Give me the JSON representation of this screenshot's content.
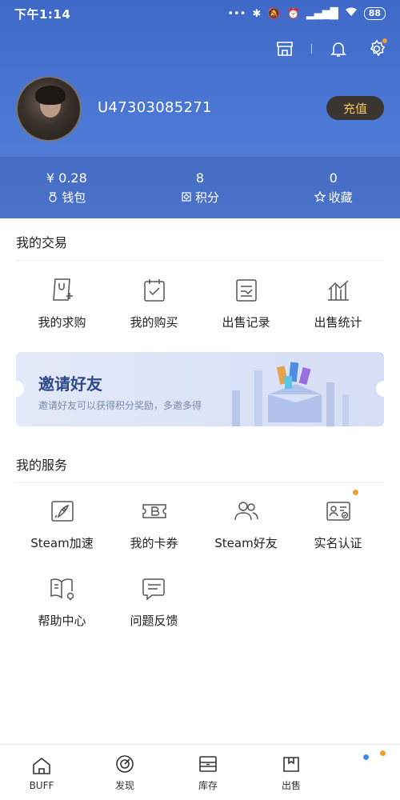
{
  "status_bar": {
    "time": "下午1:14",
    "signal": "...",
    "battery": "88"
  },
  "header": {
    "username": "U47303085271",
    "recharge_label": "充值",
    "stats": [
      {
        "value": "¥ 0.28",
        "label": "钱包",
        "icon": "wallet-icon"
      },
      {
        "value": "8",
        "label": "积分",
        "icon": "points-icon"
      },
      {
        "value": "0",
        "label": "收藏",
        "icon": "star-icon"
      }
    ]
  },
  "trade": {
    "title": "我的交易",
    "items": [
      {
        "label": "我的求购",
        "icon": "want-to-buy-icon"
      },
      {
        "label": "我的购买",
        "icon": "purchases-icon"
      },
      {
        "label": "出售记录",
        "icon": "sales-record-icon"
      },
      {
        "label": "出售统计",
        "icon": "sales-stats-icon"
      }
    ]
  },
  "banner": {
    "title": "邀请好友",
    "subtitle": "邀请好友可以获得积分奖励，多邀多得"
  },
  "services": {
    "title": "我的服务",
    "items": [
      {
        "label": "Steam加速",
        "icon": "rocket-icon"
      },
      {
        "label": "我的卡券",
        "icon": "coupon-icon"
      },
      {
        "label": "Steam好友",
        "icon": "friends-icon"
      },
      {
        "label": "实名认证",
        "icon": "id-card-icon"
      },
      {
        "label": "帮助中心",
        "icon": "help-book-icon"
      },
      {
        "label": "问题反馈",
        "icon": "feedback-icon"
      }
    ]
  },
  "bottom_nav": [
    {
      "label": "BUFF",
      "icon": "home-icon"
    },
    {
      "label": "发现",
      "icon": "discover-icon"
    },
    {
      "label": "库存",
      "icon": "inventory-icon"
    },
    {
      "label": "出售",
      "icon": "sell-icon"
    }
  ],
  "colors": {
    "header_blue": "#4d79d6",
    "accent_gold": "#f2c568",
    "badge_orange": "#f0a030"
  }
}
